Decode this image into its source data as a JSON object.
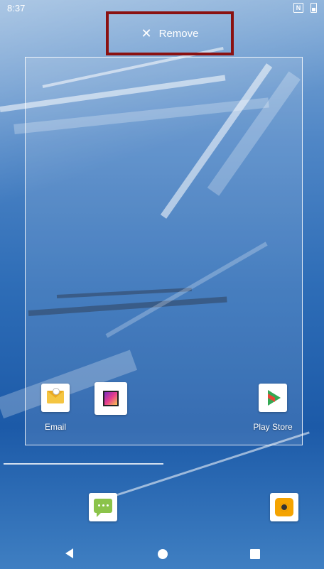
{
  "status_bar": {
    "time": "8:37",
    "sim_label": "N"
  },
  "drop_target": {
    "icon": "close-icon",
    "label": "Remove"
  },
  "widget_apps": [
    {
      "label": "Email",
      "icon": "email-icon"
    },
    {
      "label": "",
      "icon": "gallery-icon"
    },
    {
      "label": "Play Store",
      "icon": "play-store-icon"
    }
  ],
  "dock": [
    {
      "icon": "messages-icon"
    },
    {
      "icon": "music-icon"
    }
  ],
  "nav": [
    "back-icon",
    "home-icon",
    "recents-icon"
  ],
  "colors": {
    "highlight_border": "#8a1111",
    "text": "#ffffff"
  }
}
